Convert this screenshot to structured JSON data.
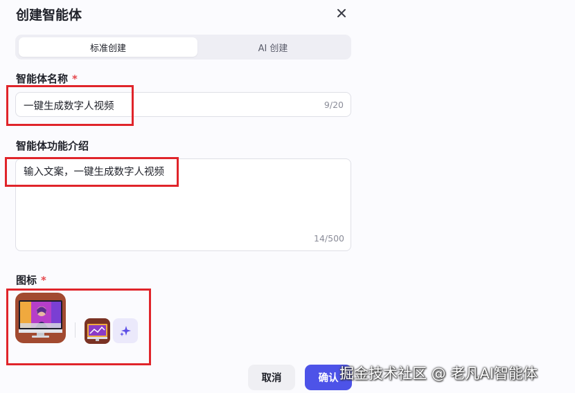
{
  "dialog": {
    "title": "创建智能体",
    "close_icon": "close-icon"
  },
  "mode_tabs": [
    {
      "label": "标准创建",
      "active": true
    },
    {
      "label": "AI 创建",
      "active": false
    }
  ],
  "name_field": {
    "label": "智能体名称",
    "required_mark": "*",
    "value": "一键生成数字人视频",
    "counter": "9/20"
  },
  "desc_field": {
    "label": "智能体功能介绍",
    "value": "输入文案，一键生成数字人视频",
    "counter": "14/500"
  },
  "icon_field": {
    "label": "图标",
    "required_mark": "*",
    "selected_icon": "monitor-avatar-icon",
    "ai_generate_icon": "sparkle-icon"
  },
  "footer": {
    "cancel_label": "取消",
    "confirm_label": "确认"
  },
  "watermark": "掘金技术社区 @ 老凡AI智能体",
  "colors": {
    "primary": "#4d53e8",
    "required": "#e5484d",
    "highlight_box": "#e0242a",
    "icon_bg": "#a24a30"
  }
}
